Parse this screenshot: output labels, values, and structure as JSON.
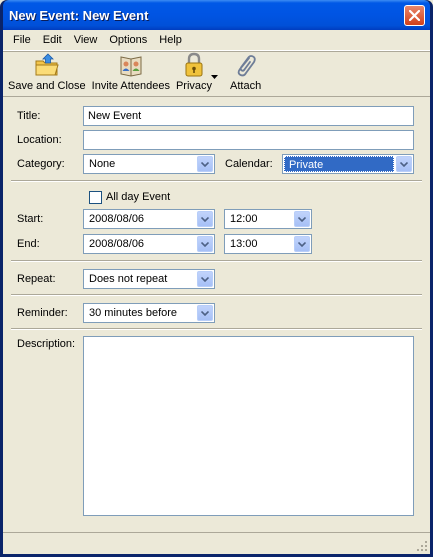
{
  "window": {
    "title": "New Event: New Event"
  },
  "menu": {
    "file": "File",
    "edit": "Edit",
    "view": "View",
    "options": "Options",
    "help": "Help"
  },
  "toolbar": {
    "save_close": "Save and Close",
    "invite": "Invite Attendees",
    "privacy": "Privacy",
    "attach": "Attach"
  },
  "fields": {
    "title_label": "Title:",
    "title_value": "New Event",
    "location_label": "Location:",
    "location_value": "",
    "category_label": "Category:",
    "category_value": "None",
    "calendar_label": "Calendar:",
    "calendar_value": "Private",
    "allday_label": "All day Event",
    "allday_checked": false,
    "start_label": "Start:",
    "start_date": "2008/08/06",
    "start_time": "12:00",
    "end_label": "End:",
    "end_date": "2008/08/06",
    "end_time": "13:00",
    "repeat_label": "Repeat:",
    "repeat_value": "Does not repeat",
    "reminder_label": "Reminder:",
    "reminder_value": "30 minutes before",
    "description_label": "Description:",
    "description_value": ""
  },
  "icons": {
    "save_close": "folder-save-icon",
    "invite": "address-book-icon",
    "privacy": "padlock-icon",
    "attach": "paperclip-icon"
  }
}
